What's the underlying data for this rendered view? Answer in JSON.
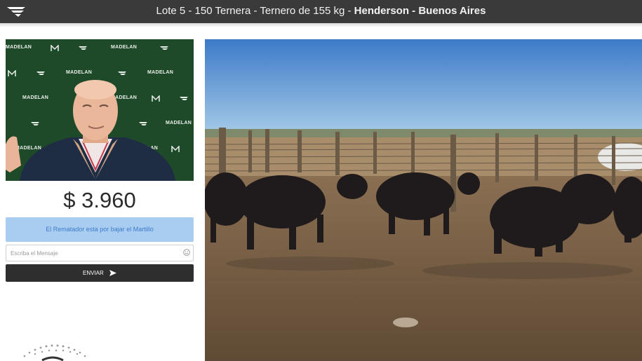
{
  "header": {
    "lot_title": "Lote 5 - 150 Ternera - Ternero de 155 kg - ",
    "location": "Henderson - Buenos Aires"
  },
  "auctioneer": {
    "brand_text": "MADELAN"
  },
  "bid": {
    "price": "$ 3.960",
    "status_message": "El Rematador esta por bajar el Martillo"
  },
  "chat": {
    "placeholder": "Escriba el Mensaje",
    "send_label": "ENVIAR"
  },
  "icons": {
    "logo": "madelan-logo-icon",
    "emoji": "emoji-icon",
    "send": "send-arrow-icon"
  },
  "colors": {
    "topbar": "#3a3a3a",
    "status_bg": "#a9cdf1",
    "status_text": "#3d7bc9",
    "send_bg": "#2e2e2e",
    "backdrop": "#1f4a2a"
  }
}
